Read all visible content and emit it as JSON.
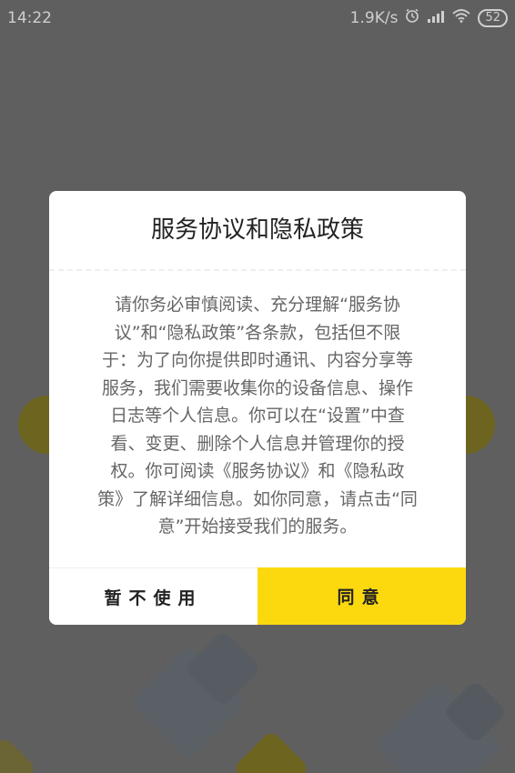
{
  "status_bar": {
    "time": "14:22",
    "network_speed": "1.9K/s",
    "battery": "52",
    "icons": [
      "alarm-clock-icon",
      "signal-icon",
      "wifi-icon",
      "battery-icon"
    ]
  },
  "dialog": {
    "title": "服务协议和隐私政策",
    "body_lines": [
      "请你务必审慎阅读、充分理解“服务协",
      "议”和“隐私政策”各条款，包括但不限",
      "于：为了向你提供即时通讯、内容分享等",
      "服务，我们需要收集你的设备信息、操作",
      "日志等个人信息。你可以在“设置”中查",
      "看、变更、删除个人信息并管理你的授",
      "权。你可阅读《服务协议》和《隐私政",
      "策》了解详细信息。如你同意，请点击“同",
      "意”开始接受我们的服务。"
    ],
    "decline_label": "暂不使用",
    "agree_label": "同意"
  },
  "colors": {
    "overlay": "#5f5f5f",
    "accent": "#fcd90f",
    "dialog_bg": "#ffffff",
    "title_text": "#222222",
    "body_text": "#666666"
  }
}
